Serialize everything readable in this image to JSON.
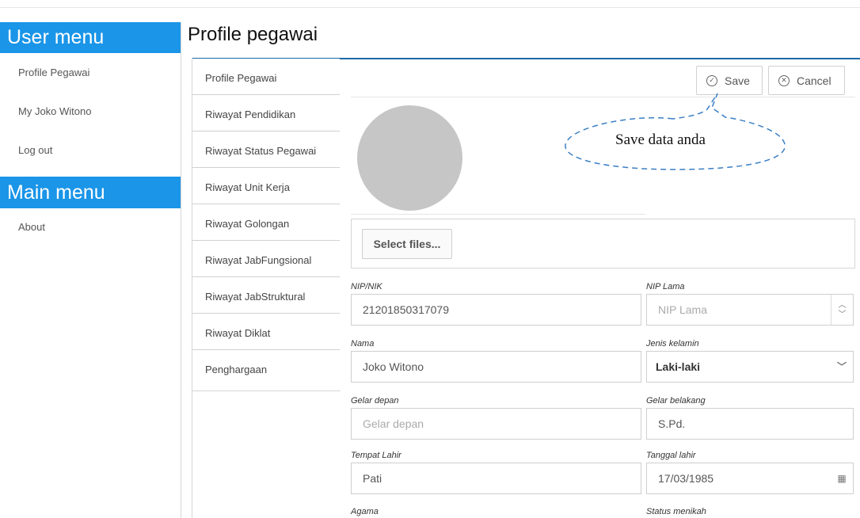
{
  "user_menu": {
    "title": "User menu",
    "items": [
      {
        "label": "Profile Pegawai"
      },
      {
        "label": "My Joko Witono"
      },
      {
        "label": "Log out"
      }
    ]
  },
  "main_menu": {
    "title": "Main menu",
    "items": [
      {
        "label": "About"
      }
    ]
  },
  "page": {
    "title": "Profile pegawai"
  },
  "tabs": [
    {
      "label": "Profile Pegawai",
      "active": true
    },
    {
      "label": "Riwayat Pendidikan"
    },
    {
      "label": "Riwayat Status Pegawai"
    },
    {
      "label": "Riwayat Unit Kerja"
    },
    {
      "label": "Riwayat Golongan"
    },
    {
      "label": "Riwayat JabFungsional"
    },
    {
      "label": "Riwayat JabStruktural"
    },
    {
      "label": "Riwayat Diklat"
    },
    {
      "label": "Penghargaan"
    }
  ],
  "toolbar": {
    "save_label": "Save",
    "cancel_label": "Cancel"
  },
  "callout": {
    "text": "Save data anda"
  },
  "upload": {
    "button_label": "Select files..."
  },
  "form": {
    "nip": {
      "label": "NIP/NIK",
      "value": "21201850317079"
    },
    "nip_lama": {
      "label": "NIP Lama",
      "placeholder": "NIP Lama"
    },
    "nama": {
      "label": "Nama",
      "value": "Joko Witono"
    },
    "jenis_kelamin": {
      "label": "Jenis kelamin",
      "value": "Laki-laki"
    },
    "gelar_depan": {
      "label": "Gelar depan",
      "placeholder": "Gelar depan"
    },
    "gelar_belakang": {
      "label": "Gelar belakang",
      "value": "S.Pd."
    },
    "tempat_lahir": {
      "label": "Tempat Lahir",
      "value": "Pati"
    },
    "tanggal_lahir": {
      "label": "Tanggal lahir",
      "value": "17/03/1985"
    },
    "agama": {
      "label": "Agama"
    },
    "status_menikah": {
      "label": "Status menikah"
    }
  },
  "icons": {
    "save": "check-circle-icon",
    "cancel": "close-circle-icon",
    "spinner": "spinner-arrows-icon",
    "dropdown": "chevron-down-icon",
    "calendar": "calendar-icon"
  },
  "colors": {
    "menu_header": "#1a95e8",
    "active_tab_border": "#1b6aa6",
    "avatar": "#c6c6c6",
    "callout_stroke": "#3b7fc4"
  }
}
